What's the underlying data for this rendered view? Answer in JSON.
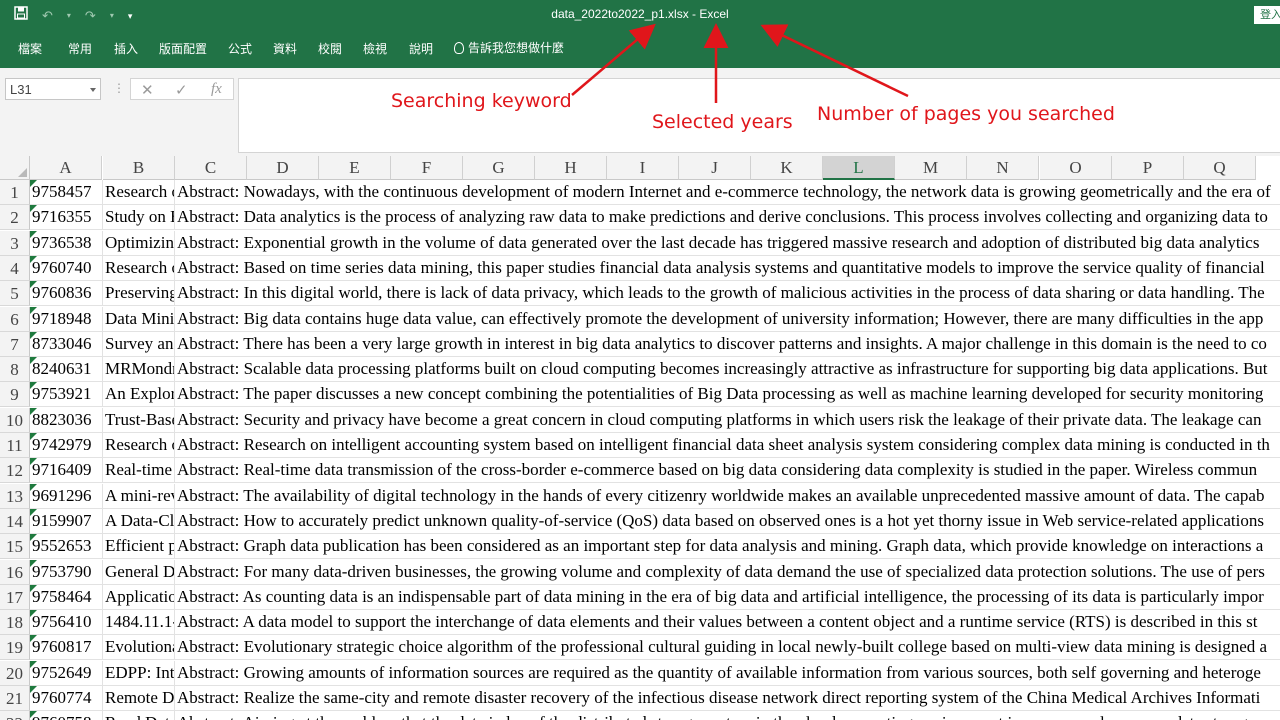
{
  "window": {
    "title": "data_2022to2022_p1.xlsx  -  Excel",
    "signin": "登入"
  },
  "qat": {
    "save_icon": "save-icon",
    "undo_icon": "undo-icon",
    "redo_icon": "redo-icon",
    "customize_icon": "customize-icon"
  },
  "ribbon": {
    "tabs": [
      "檔案",
      "常用",
      "插入",
      "版面配置",
      "公式",
      "資料",
      "校閱",
      "檢視",
      "說明"
    ],
    "tell_me": "告訴我您想做什麼"
  },
  "formula": {
    "name_box": "L31",
    "cancel": "✕",
    "enter": "✓",
    "fx": "fx",
    "content": ""
  },
  "annotations": {
    "keyword": "Searching keyword",
    "years": "Selected years",
    "pages": "Number of pages you searched",
    "color": "#e0161b"
  },
  "colors": {
    "excel_green": "#217346"
  },
  "columns": [
    "A",
    "B",
    "C",
    "D",
    "E",
    "F",
    "G",
    "H",
    "I",
    "J",
    "K",
    "L",
    "M",
    "N",
    "O",
    "P",
    "Q"
  ],
  "selected_column": "L",
  "rows": [
    {
      "n": "1",
      "a": "9758457",
      "b": "Research o",
      "c": "Abstract: Nowadays, with the continuous development of modern Internet and e-commerce technology, the network data is growing geometrically and the era of"
    },
    {
      "n": "2",
      "a": "9716355",
      "b": "Study on B",
      "c": "Abstract: Data analytics is the process of analyzing raw data to make predictions and derive conclusions. This process involves collecting and organizing data to"
    },
    {
      "n": "3",
      "a": "9736538",
      "b": "Optimizing",
      "c": "Abstract: Exponential growth in the volume of data generated over the last decade has triggered massive research and adoption of distributed big data analytics"
    },
    {
      "n": "4",
      "a": "9760740",
      "b": "Research o",
      "c": "Abstract: Based on time series data mining, this paper studies financial data analysis systems and quantitative models to improve the service quality of financial"
    },
    {
      "n": "5",
      "a": "9760836",
      "b": "Preserving",
      "c": "Abstract: In this digital world, there is lack of data privacy, which leads to the growth of malicious activities in the process of data sharing or data handling. The"
    },
    {
      "n": "6",
      "a": "9718948",
      "b": "Data Minin",
      "c": "Abstract: Big data contains huge data value, can effectively promote the development of university information; However, there are many difficulties in the app"
    },
    {
      "n": "7",
      "a": "8733046",
      "b": "Survey and",
      "c": "Abstract: There has been a very large growth in interest in big data analytics to discover patterns and insights. A major challenge in this domain is the need to co"
    },
    {
      "n": "8",
      "a": "8240631",
      "b": "MRMondri",
      "c": "Abstract: Scalable data processing platforms built on cloud computing becomes increasingly attractive as infrastructure for supporting big data applications. But"
    },
    {
      "n": "9",
      "a": "9753921",
      "b": "An Explora",
      "c": "Abstract: The paper discusses a new concept combining the potentialities of Big Data processing as well as machine learning developed for security monitoring"
    },
    {
      "n": "10",
      "a": "8823036",
      "b": "Trust-Base",
      "c": "Abstract: Security and privacy have become a great concern in cloud computing platforms in which users risk the leakage of their private data. The leakage can"
    },
    {
      "n": "11",
      "a": "9742979",
      "b": "Research o",
      "c": "Abstract: Research on intelligent accounting system based on intelligent financial data sheet analysis system considering complex data mining is conducted in th"
    },
    {
      "n": "12",
      "a": "9716409",
      "b": "Real-time d",
      "c": "Abstract: Real-time data transmission of the cross-border e-commerce based on big data considering data complexity is studied in the paper. Wireless commun"
    },
    {
      "n": "13",
      "a": "9691296",
      "b": "A mini-rev",
      "c": "Abstract: The availability of digital technology in the hands of every citizenry worldwide makes an available unprecedented massive amount of data. The capab"
    },
    {
      "n": "14",
      "a": "9159907",
      "b": "A Data-Cla",
      "c": "Abstract: How to accurately predict unknown quality-of-service (QoS) data based on observed ones is a hot yet thorny issue in Web service-related applications"
    },
    {
      "n": "15",
      "a": "9552653",
      "b": "Efficient p",
      "c": "Abstract: Graph data publication has been considered as an important step for data analysis and mining. Graph data, which provide knowledge on interactions a"
    },
    {
      "n": "16",
      "a": "9753790",
      "b": "General Da",
      "c": "Abstract: For many data-driven businesses, the growing volume and complexity of data demand the use of specialized data protection solutions. The use of pers"
    },
    {
      "n": "17",
      "a": "9758464",
      "b": "Application",
      "c": "Abstract: As counting data is an indispensable part of data mining in the era of big data and artificial intelligence, the processing of its data is particularly impor"
    },
    {
      "n": "18",
      "a": "9756410",
      "b": "1484.11.1-",
      "c": "Abstract: A data model to support the interchange of data elements and their values between a content object and a runtime service (RTS) is described in this st"
    },
    {
      "n": "19",
      "a": "9760817",
      "b": "Evolutiona",
      "c": "Abstract: Evolutionary strategic choice algorithm of the professional cultural guiding in local newly-built college based on multi-view data mining is designed a"
    },
    {
      "n": "20",
      "a": "9752649",
      "b": "EDPP: Inte",
      "c": "Abstract: Growing amounts of information sources are required as the quantity of available information from various sources, both self governing and heteroge"
    },
    {
      "n": "21",
      "a": "9760774",
      "b": "Remote Di",
      "c": "Abstract: Realize the same-city and remote disaster recovery of the infectious disease network direct reporting system of the China Medical Archives Informati"
    },
    {
      "n": "22",
      "a": "9760758",
      "b": "Road Data",
      "c": "Abstract: Aiming at the problem that the data index of the distributed storage system in the cloud computing environment is more complex, a new data storage"
    }
  ]
}
